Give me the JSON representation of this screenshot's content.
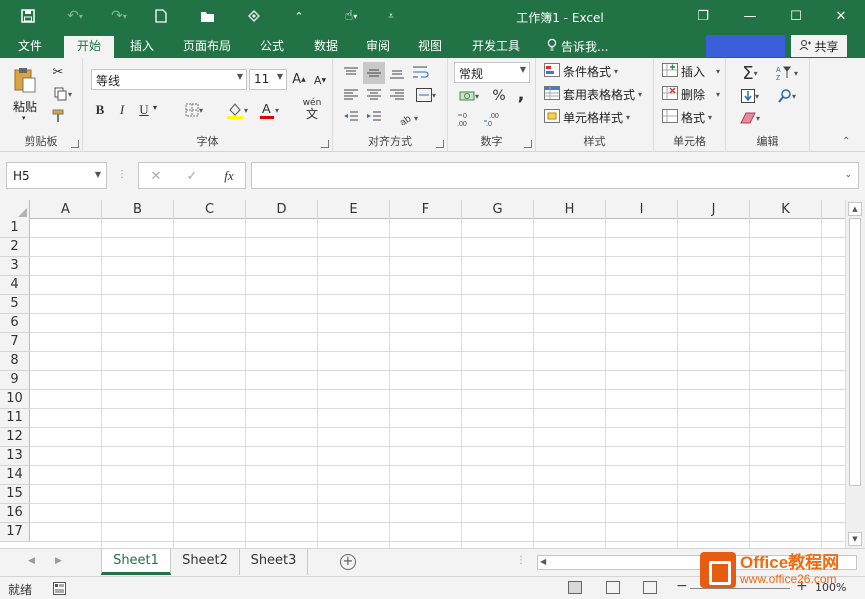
{
  "window": {
    "title": "工作簿1 - Excel",
    "quick_access": [
      "save-icon",
      "undo-icon",
      "redo-icon",
      "new-file-icon",
      "open-folder-icon",
      "touch-mode-icon",
      "customize-icon"
    ],
    "controls": {
      "restore": "❐",
      "minimize": "—",
      "maximize": "☐",
      "close": "✕"
    }
  },
  "tabs": {
    "file": "文件",
    "home": "开始",
    "insert": "插入",
    "layout": "页面布局",
    "formulas": "公式",
    "data": "数据",
    "review": "审阅",
    "view": "视图",
    "developer": "开发工具",
    "tell_me": "告诉我...",
    "share": "共享"
  },
  "ribbon": {
    "clipboard": {
      "paste": "粘贴",
      "label": "剪贴板"
    },
    "font": {
      "name": "等线",
      "size": "11",
      "label": "字体",
      "bold": "B",
      "italic": "I",
      "underline": "U",
      "wen": "wén"
    },
    "alignment": {
      "label": "对齐方式"
    },
    "number": {
      "format": "常规",
      "percent": "%",
      "comma": ",",
      "label": "数字"
    },
    "styles": {
      "conditional": "条件格式",
      "table": "套用表格格式",
      "cell": "单元格样式",
      "label": "样式"
    },
    "cells": {
      "insert": "插入",
      "delete": "删除",
      "format": "格式",
      "label": "单元格"
    },
    "editing": {
      "label": "编辑"
    }
  },
  "formula_bar": {
    "name_box": "H5",
    "cancel": "✕",
    "enter": "✓",
    "fx": "fx",
    "value": ""
  },
  "grid": {
    "columns": [
      "A",
      "B",
      "C",
      "D",
      "E",
      "F",
      "G",
      "H",
      "I",
      "J",
      "K"
    ],
    "rows": [
      "1",
      "2",
      "3",
      "4",
      "5",
      "6",
      "7",
      "8",
      "9",
      "10",
      "11",
      "12",
      "13",
      "14",
      "15",
      "16",
      "17"
    ]
  },
  "sheets": {
    "tabs": [
      "Sheet1",
      "Sheet2",
      "Sheet3"
    ],
    "active": "Sheet1",
    "add": "+"
  },
  "status": {
    "ready": "就绪",
    "zoom": "100%"
  },
  "watermark": {
    "line1": "Office教程网",
    "line2": "www.office26.com"
  }
}
